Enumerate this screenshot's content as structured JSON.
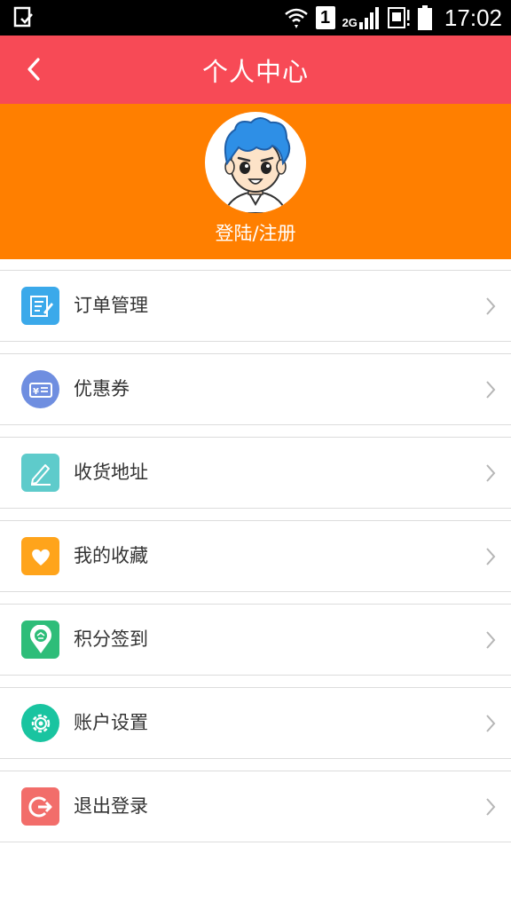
{
  "status_bar": {
    "time": "17:02",
    "network": "2G",
    "sim": "1"
  },
  "header": {
    "title": "个人中心",
    "back_icon": "chevron-left-icon"
  },
  "profile": {
    "login_label": "登陆/注册"
  },
  "menu": {
    "items": [
      {
        "label": "订单管理",
        "icon": "order-edit-icon",
        "color": "#3ba9ea"
      },
      {
        "label": "优惠券",
        "icon": "coupon-icon",
        "color": "#6f8ee0"
      },
      {
        "label": "收货地址",
        "icon": "address-pencil-icon",
        "color": "#5ecbcb"
      },
      {
        "label": "我的收藏",
        "icon": "heart-icon",
        "color": "#ffa41b"
      },
      {
        "label": "积分签到",
        "icon": "checkin-pin-icon",
        "color": "#2ebd79"
      },
      {
        "label": "账户设置",
        "icon": "gear-icon",
        "color": "#19c4a0"
      },
      {
        "label": "退出登录",
        "icon": "logout-icon",
        "color": "#f26d6a"
      }
    ]
  },
  "colors": {
    "title_bar": "#f74a56",
    "profile_bg": "#ff7f00"
  }
}
